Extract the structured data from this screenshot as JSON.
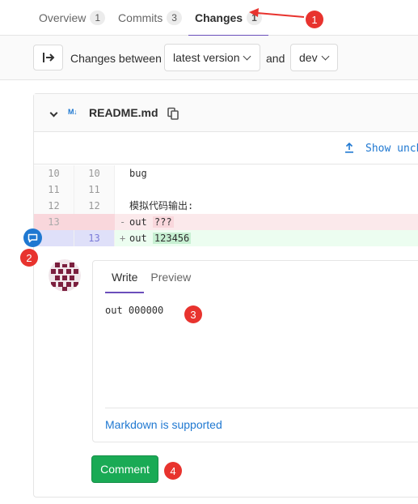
{
  "tabs": [
    {
      "label": "Overview",
      "count": "1"
    },
    {
      "label": "Commits",
      "count": "3"
    },
    {
      "label": "Changes",
      "count": "1"
    }
  ],
  "toolbar": {
    "changes_between": "Changes between",
    "version_select": "latest version",
    "and": "and",
    "branch_select": "dev"
  },
  "file": {
    "icon": "M↓",
    "name": "README.md",
    "show_text": "Show unchanged lines"
  },
  "diff_lines": [
    {
      "old": "10",
      "new": "10",
      "sign": " ",
      "text": "bug",
      "type": "context"
    },
    {
      "old": "11",
      "new": "11",
      "sign": " ",
      "text": "",
      "type": "context"
    },
    {
      "old": "12",
      "new": "12",
      "sign": " ",
      "text": "模拟代码输出:",
      "type": "context"
    },
    {
      "old": "13",
      "new": "",
      "sign": "-",
      "prefix": "out ",
      "changed": "???",
      "type": "del"
    },
    {
      "old": "",
      "new": "13",
      "sign": "+",
      "prefix": "out ",
      "changed": "123456",
      "type": "add"
    }
  ],
  "editor": {
    "write_tab": "Write",
    "preview_tab": "Preview",
    "content": "out 000000",
    "markdown_hint": "Markdown is supported"
  },
  "comment_button": "Comment",
  "markers": [
    "1",
    "2",
    "3",
    "4"
  ],
  "colors": {
    "accent": "#6b4fbb",
    "link": "#1f78d1",
    "comment_button": "#1aaa55",
    "marker": "#e8332e"
  }
}
